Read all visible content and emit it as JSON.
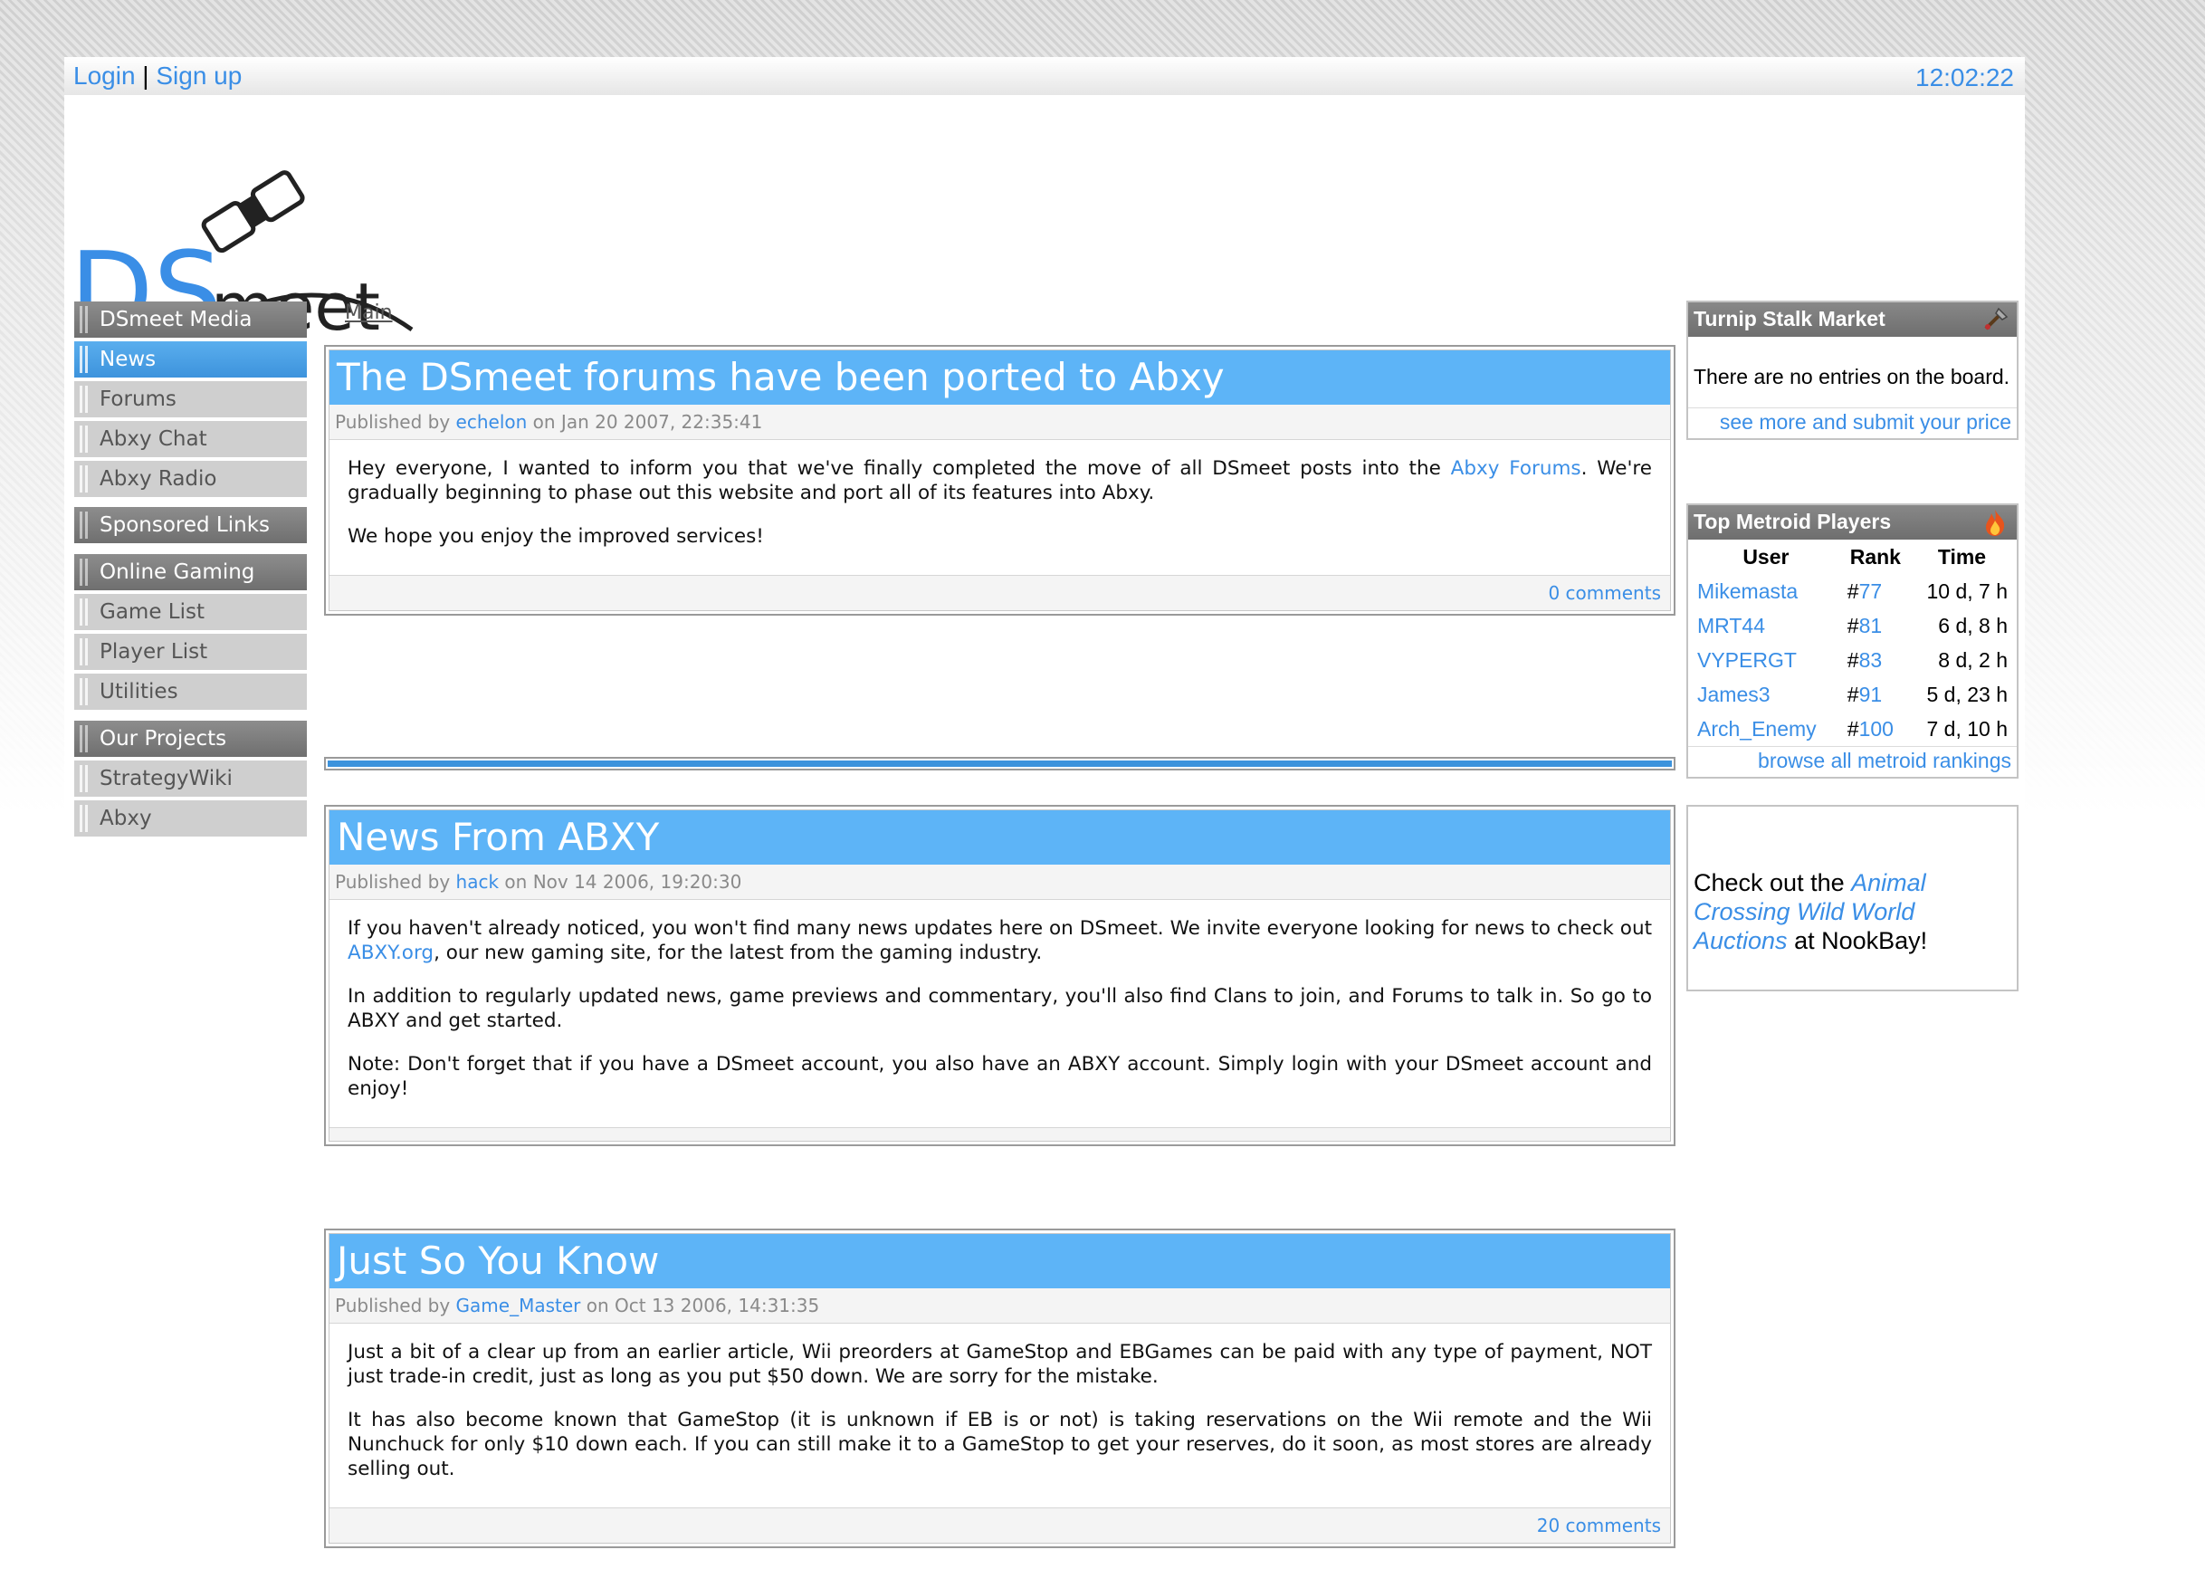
{
  "topbar": {
    "login": "Login",
    "separator": "|",
    "signup": "Sign up",
    "clock": "12:02:22"
  },
  "logo": {
    "text_ds": "DS",
    "text_meet": "meet"
  },
  "nav": {
    "groups": [
      {
        "heading": "DSmeet Media",
        "items": [
          "News",
          "Forums",
          "Abxy Chat",
          "Abxy Radio"
        ],
        "active": "News"
      },
      {
        "heading": "Sponsored Links",
        "items": []
      },
      {
        "heading": "Online Gaming",
        "items": [
          "Game List",
          "Player List",
          "Utilities"
        ]
      },
      {
        "heading": "Our Projects",
        "items": [
          "StrategyWiki",
          "Abxy"
        ]
      }
    ]
  },
  "breadcrumb": "Main",
  "articles": [
    {
      "title": "The DSmeet forums have been ported to Abxy",
      "published_by": "Published by",
      "author": "echelon",
      "date": "on Jan 20 2007, 22:35:41",
      "p1_a": "Hey everyone, I wanted to inform you that we've finally completed the move of all DSmeet posts into the ",
      "p1_link": "Abxy Forums",
      "p1_b": ". We're gradually beginning to phase out this website and port all of its features into Abxy.",
      "p2": "We hope you enjoy the improved services!",
      "comments": "0 comments"
    },
    {
      "title": "News From ABXY",
      "published_by": "Published by",
      "author": "hack",
      "date": "on Nov 14 2006, 19:20:30",
      "p1_a": "If you haven't already noticed, you won't find many news updates here on DSmeet. We invite everyone looking for news to check out ",
      "p1_link": "ABXY.org",
      "p1_b": ", our new gaming site, for the latest from the gaming industry.",
      "p2": "In addition to regularly updated news, game previews and commentary, you'll also find Clans to join, and Forums to talk in. So go to ABXY and get started.",
      "p3": "Note: Don't forget that if you have a DSmeet account, you also have an ABXY account. Simply login with your DSmeet account and enjoy!"
    },
    {
      "title": "Just So You Know",
      "published_by": "Published by",
      "author": "Game_Master",
      "date": "on Oct 13 2006, 14:31:35",
      "p1": "Just a bit of a clear up from an earlier article, Wii preorders at GameStop and EBGames can be paid with any type of payment, NOT just trade-in credit, just as long as you put $50 down. We are sorry for the mistake.",
      "p2": "It has also become known that GameStop (it is unknown if EB is or not) is taking reservations on the Wii remote and the Wii Nunchuck for only $10 down each. If you can still make it to a GameStop to get your reserves, do it soon, as most stores are already selling out.",
      "comments": "20 comments"
    }
  ],
  "turnip": {
    "title": "Turnip Stalk Market",
    "message": "There are no entries on the board.",
    "link": "see more and submit your price",
    "icon": "shovel-icon"
  },
  "metroid": {
    "title": "Top Metroid Players",
    "icon": "fire-icon",
    "headers": [
      "User",
      "Rank",
      "Time"
    ],
    "rows": [
      {
        "user": "Mikemasta",
        "hash": "#",
        "rank": "77",
        "time": "10 d, 7 h"
      },
      {
        "user": "MRT44",
        "hash": "#",
        "rank": "81",
        "time": "6 d, 8 h"
      },
      {
        "user": "VYPERGT",
        "hash": "#",
        "rank": "83",
        "time": "8 d, 2 h"
      },
      {
        "user": "James3",
        "hash": "#",
        "rank": "91",
        "time": "5 d, 23 h"
      },
      {
        "user": "Arch_Enemy",
        "hash": "#",
        "rank": "100",
        "time": "7 d, 10 h"
      }
    ],
    "link": "browse all metroid rankings"
  },
  "promo": {
    "before": "Check out the ",
    "link": "Animal Crossing Wild World Auctions",
    "after": " at NookBay!"
  },
  "colors": {
    "accent": "#3a8ee6",
    "title_bar": "#5db4f7",
    "nav_head": "#7a7a7a"
  }
}
